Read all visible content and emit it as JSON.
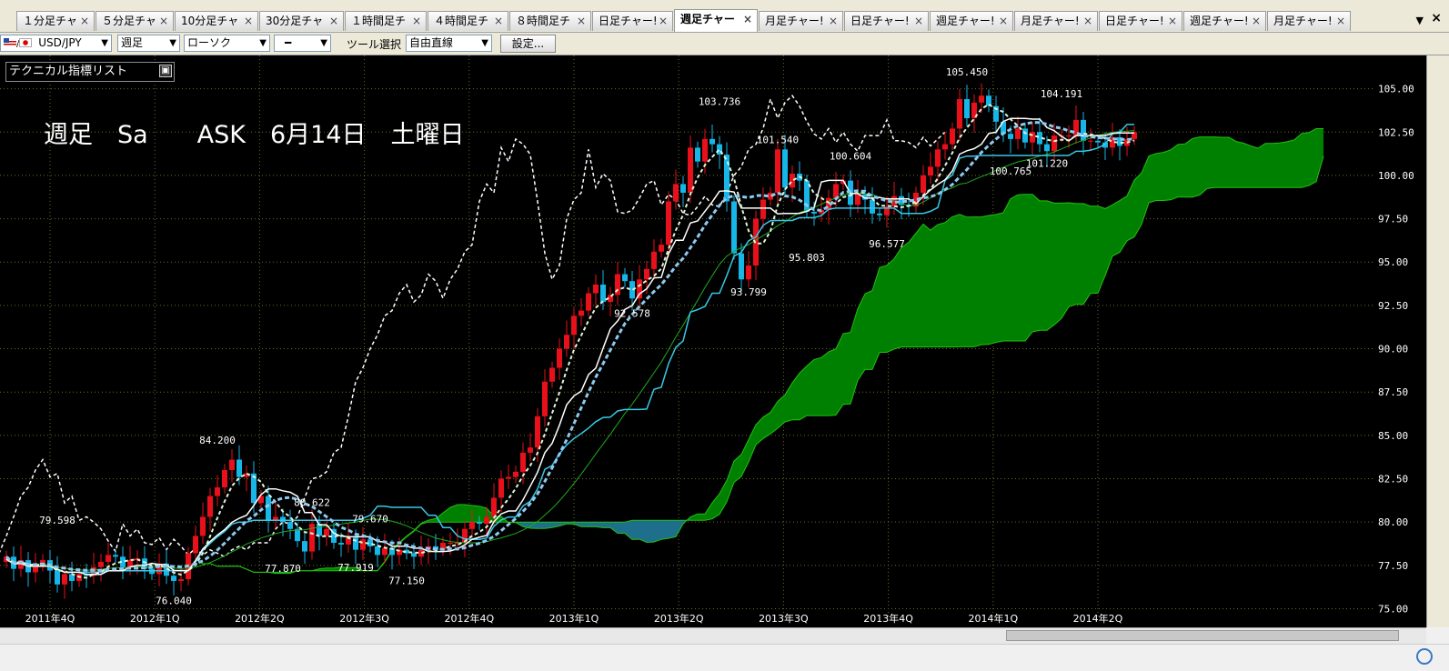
{
  "tabs": [
    {
      "label": "１分足チャ",
      "width": 86
    },
    {
      "label": "５分足チャ",
      "width": 86
    },
    {
      "label": "10分足チャ",
      "width": 92
    },
    {
      "label": "30分足チャ",
      "width": 93
    },
    {
      "label": "１時間足チ",
      "width": 90
    },
    {
      "label": "４時間足チ",
      "width": 89
    },
    {
      "label": "８時間足チ",
      "width": 90
    },
    {
      "label": "日足チャー!",
      "width": 89
    },
    {
      "label": "週足チャー",
      "width": 92,
      "active": true
    },
    {
      "label": "月足チャー!",
      "width": 93
    },
    {
      "label": "日足チャー!",
      "width": 93
    },
    {
      "label": "週足チャー!",
      "width": 92
    },
    {
      "label": "月足チャー!",
      "width": 92
    },
    {
      "label": "日足チャー!",
      "width": 92
    },
    {
      "label": "週足チャー!",
      "width": 91
    },
    {
      "label": "月足チャー!",
      "width": 92
    }
  ],
  "toolbar": {
    "symbol": "USD/JPY",
    "period": "週足",
    "chart_type": "ローソク",
    "line_style": "━",
    "tool_label": "ツール選択",
    "tool": "自由直線",
    "settings": "設定..."
  },
  "indicator_panel": "テクニカル指標リスト",
  "title": "週足　Sa　　ASK　6月14日　土曜日",
  "colors": {
    "background": "#000000",
    "up_candle": "#e8101a",
    "down_candle": "#17b6e8",
    "kumo_bull": "#008000",
    "kumo_bear": "#1e6f8c",
    "tenkan": "#ffffff",
    "kijun": "#39c8e6",
    "span_line": "#26c81e",
    "chikou": "#ffffff",
    "ma_dashed_light": "#dff5d8",
    "ma_dashed_blue": "#8ec9ee"
  },
  "chart_data": {
    "type": "candlestick",
    "symbol": "USD/JPY",
    "ylim": [
      74.5,
      106.5
    ],
    "y_ticks": [
      "105.00",
      "102.50",
      "100.00",
      "97.50",
      "95.00",
      "92.50",
      "90.00",
      "87.50",
      "85.00",
      "82.50",
      "80.00",
      "77.50",
      "75.00"
    ],
    "x_ticks": [
      "2011年4Q",
      "2012年1Q",
      "2012年2Q",
      "2012年3Q",
      "2012年4Q",
      "2013年1Q",
      "2013年2Q",
      "2013年3Q",
      "2013年4Q",
      "2014年1Q",
      "2014年2Q"
    ],
    "close": [
      78.0,
      77.3,
      77.8,
      77.1,
      77.5,
      77.8,
      77.2,
      76.4,
      77.0,
      76.6,
      77.0,
      76.9,
      77.4,
      77.7,
      78.1,
      78.0,
      77.4,
      77.8,
      77.9,
      77.3,
      77.0,
      77.6,
      76.9,
      76.6,
      76.7,
      78.2,
      79.2,
      80.3,
      81.5,
      82.0,
      83.0,
      83.6,
      82.6,
      82.8,
      81.1,
      81.5,
      80.1,
      80.3,
      80.0,
      79.6,
      78.9,
      78.3,
      79.9,
      79.2,
      79.6,
      78.8,
      78.7,
      79.1,
      78.4,
      79.0,
      78.6,
      78.1,
      78.5,
      78.1,
      78.4,
      78.2,
      78.0,
      78.4,
      78.6,
      78.4,
      78.8,
      78.8,
      78.8,
      79.6,
      80.0,
      79.9,
      80.3,
      81.4,
      82.5,
      82.6,
      82.9,
      84.0,
      84.3,
      86.1,
      88.1,
      88.9,
      90.0,
      90.8,
      91.9,
      92.2,
      93.2,
      93.7,
      92.7,
      93.1,
      94.3,
      93.9,
      92.9,
      94.0,
      94.6,
      95.6,
      96.0,
      98.5,
      99.5,
      99.0,
      101.6,
      100.8,
      102.1,
      101.8,
      101.2,
      98.5,
      95.5,
      94.0,
      94.8,
      97.5,
      98.6,
      99.0,
      101.5,
      99.3,
      100.1,
      99.7,
      97.9,
      97.8,
      98.0,
      98.7,
      99.5,
      99.7,
      98.3,
      98.9,
      98.6,
      97.8,
      97.7,
      98.2,
      98.8,
      98.3,
      98.2,
      99.0,
      100.0,
      100.5,
      101.5,
      101.8,
      102.7,
      104.4,
      103.3,
      104.2,
      104.6,
      104.0,
      103.1,
      102.4,
      102.1,
      102.7,
      101.9,
      102.5,
      101.8,
      101.4,
      102.3,
      102.3,
      102.3,
      103.2,
      102.0,
      102.0,
      101.9,
      101.6,
      102.2,
      101.7,
      102.1,
      102.5
    ],
    "open": [
      77.7,
      78.0,
      77.3,
      77.8,
      77.1,
      77.5,
      77.8,
      77.2,
      76.4,
      77.0,
      76.6,
      77.0,
      76.9,
      77.4,
      77.7,
      78.1,
      78.0,
      77.4,
      77.8,
      77.9,
      77.3,
      77.0,
      77.6,
      76.9,
      76.6,
      76.7,
      78.2,
      79.2,
      80.3,
      81.5,
      82.0,
      83.0,
      83.6,
      82.6,
      82.8,
      81.1,
      81.5,
      80.1,
      80.3,
      80.0,
      79.6,
      78.9,
      78.3,
      79.9,
      79.2,
      79.6,
      78.8,
      78.7,
      79.1,
      78.4,
      79.0,
      78.6,
      78.1,
      78.5,
      78.1,
      78.4,
      78.2,
      78.0,
      78.4,
      78.6,
      78.4,
      78.8,
      78.8,
      78.8,
      79.6,
      80.0,
      79.9,
      80.3,
      81.4,
      82.5,
      82.6,
      82.9,
      84.0,
      84.3,
      86.1,
      88.1,
      88.9,
      90.0,
      90.8,
      91.9,
      92.2,
      93.2,
      93.7,
      92.7,
      93.1,
      94.3,
      93.9,
      92.9,
      94.0,
      94.6,
      95.6,
      96.0,
      98.5,
      99.5,
      99.0,
      101.6,
      100.8,
      102.1,
      101.8,
      101.2,
      98.5,
      95.5,
      94.0,
      94.8,
      97.5,
      98.6,
      99.0,
      101.5,
      99.3,
      100.1,
      99.7,
      97.9,
      97.8,
      98.0,
      98.7,
      99.5,
      99.7,
      98.3,
      98.9,
      98.6,
      97.8,
      97.7,
      98.2,
      98.8,
      98.3,
      98.2,
      99.0,
      100.0,
      100.5,
      101.5,
      101.8,
      102.7,
      104.4,
      103.3,
      104.2,
      104.6,
      104.0,
      103.1,
      102.4,
      102.1,
      102.7,
      101.9,
      102.5,
      101.8,
      101.4,
      102.3,
      102.3,
      102.3,
      103.2,
      102.0,
      102.0,
      101.9,
      101.6,
      102.2,
      101.7,
      102.1
    ],
    "high_low_labels": [
      {
        "text": "84.200",
        "value": 84.2,
        "index": 29
      },
      {
        "text": "79.598",
        "value": 79.6,
        "index": 7
      },
      {
        "text": "76.040",
        "value": 76.0,
        "index": 23
      },
      {
        "text": "80.622",
        "value": 80.6,
        "index": 42
      },
      {
        "text": "77.870",
        "value": 77.87,
        "index": 38
      },
      {
        "text": "79.670",
        "value": 79.67,
        "index": 50
      },
      {
        "text": "77.919",
        "value": 77.92,
        "index": 48
      },
      {
        "text": "77.150",
        "value": 77.15,
        "index": 55
      },
      {
        "text": "103.736",
        "value": 103.74,
        "index": 98
      },
      {
        "text": "92.578",
        "value": 92.58,
        "index": 86
      },
      {
        "text": "93.799",
        "value": 93.8,
        "index": 102
      },
      {
        "text": "101.540",
        "value": 101.54,
        "index": 106
      },
      {
        "text": "95.803",
        "value": 95.8,
        "index": 110
      },
      {
        "text": "100.604",
        "value": 100.6,
        "index": 116
      },
      {
        "text": "96.577",
        "value": 96.58,
        "index": 121
      },
      {
        "text": "105.450",
        "value": 105.45,
        "index": 132
      },
      {
        "text": "100.765",
        "value": 100.77,
        "index": 138
      },
      {
        "text": "101.220",
        "value": 101.22,
        "index": 143
      },
      {
        "text": "104.191",
        "value": 104.19,
        "index": 145
      }
    ]
  }
}
